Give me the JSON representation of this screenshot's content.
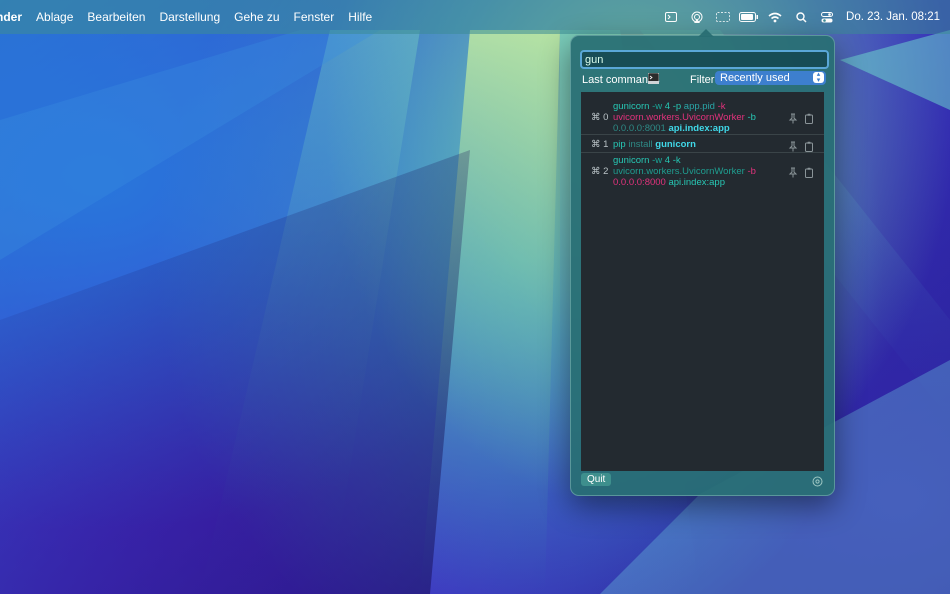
{
  "menubar": {
    "app_name": "nder",
    "items": [
      "Ablage",
      "Bearbeiten",
      "Darstellung",
      "Gehe zu",
      "Fenster",
      "Hilfe"
    ],
    "status_icons": [
      "terminal-icon",
      "airplay-icon",
      "screen-mirroring-icon",
      "battery-icon",
      "wifi-icon",
      "search-icon",
      "control-center-icon"
    ],
    "clock": "Do. 23. Jan.  08:21"
  },
  "popover": {
    "search_value": "gun",
    "last_commands_label": "Last commands",
    "filter_label": "Filter",
    "filter_selected": "Recently used",
    "quit_label": "Quit",
    "commands": [
      {
        "shortcut": "⌘ 0",
        "tokens": [
          {
            "text": "gunicorn",
            "style": "t-cmd"
          },
          {
            "text": " -w ",
            "style": "t-flag"
          },
          {
            "text": "4",
            "style": "t-num"
          },
          {
            "text": " -p ",
            "style": "t-num"
          },
          {
            "text": "app.pid",
            "style": "t-arg"
          },
          {
            "text": " -k",
            "style": "t-pink"
          },
          {
            "text": "uvicorn.workers.UvicornWorker",
            "style": "t-pink",
            "break_before": true
          },
          {
            "text": " -b",
            "style": "t-cmd"
          },
          {
            "text": "0.0.0.0:8001",
            "style": "t-dim",
            "break_before": true
          },
          {
            "text": " api.index:app",
            "style": "t-bold"
          }
        ]
      },
      {
        "shortcut": "⌘ 1",
        "tokens": [
          {
            "text": "pip",
            "style": "t-cmd"
          },
          {
            "text": " install ",
            "style": "t-dim"
          },
          {
            "text": "gunicorn",
            "style": "t-bold"
          }
        ]
      },
      {
        "shortcut": "⌘ 2",
        "tokens": [
          {
            "text": "gunicorn",
            "style": "t-cmd"
          },
          {
            "text": " -w ",
            "style": "t-flag"
          },
          {
            "text": "4",
            "style": "t-num"
          },
          {
            "text": " -k",
            "style": "t-num"
          },
          {
            "text": "uvicorn.workers.UvicornWorker",
            "style": "t-sub",
            "break_before": true
          },
          {
            "text": " -b",
            "style": "t-pink"
          },
          {
            "text": "0.0.0.0:8000",
            "style": "t-pink",
            "break_before": true
          },
          {
            "text": " api.index:app",
            "style": "t-cmd"
          }
        ]
      }
    ]
  }
}
